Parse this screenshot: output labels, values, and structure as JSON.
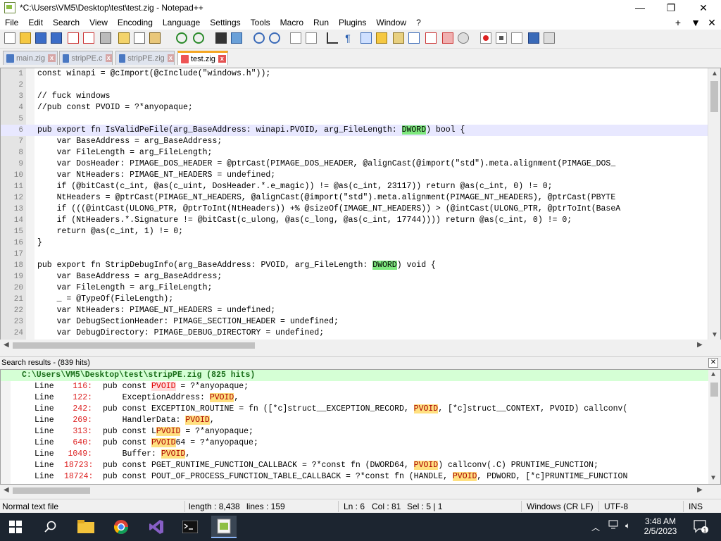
{
  "window": {
    "title": "*C:\\Users\\VM5\\Desktop\\test\\test.zig - Notepad++",
    "minimize": "—",
    "maximize": "❐",
    "close": "✕"
  },
  "menu": {
    "items": [
      "File",
      "Edit",
      "Search",
      "View",
      "Encoding",
      "Language",
      "Settings",
      "Tools",
      "Macro",
      "Run",
      "Plugins",
      "Window",
      "?"
    ],
    "plus": "+",
    "dropdown": "▼",
    "close": "✕"
  },
  "tabs": [
    {
      "label": "main.zig"
    },
    {
      "label": "stripPE.c"
    },
    {
      "label": "stripPE.zig"
    },
    {
      "label": "test.zig"
    }
  ],
  "editor": {
    "lines": [
      {
        "n": "1",
        "pre": "const winapi = @cImport(@cInclude(\"windows.h\"));"
      },
      {
        "n": "2",
        "pre": ""
      },
      {
        "n": "3",
        "pre": "// fuck windows"
      },
      {
        "n": "4",
        "pre": "//pub const PVOID = ?*anyopaque;"
      },
      {
        "n": "5",
        "pre": ""
      },
      {
        "n": "6",
        "pre": "pub export fn IsValidPeFile(arg_BaseAddress: winapi.PVOID, arg_FileLength: ",
        "hl": "DWORD",
        "post": ") bool {"
      },
      {
        "n": "7",
        "pre": "    var BaseAddress = arg_BaseAddress;"
      },
      {
        "n": "8",
        "pre": "    var FileLength = arg_FileLength;"
      },
      {
        "n": "9",
        "pre": "    var DosHeader: PIMAGE_DOS_HEADER = @ptrCast(PIMAGE_DOS_HEADER, @alignCast(@import(\"std\").meta.alignment(PIMAGE_DOS_"
      },
      {
        "n": "10",
        "pre": "    var NtHeaders: PIMAGE_NT_HEADERS = undefined;"
      },
      {
        "n": "11",
        "pre": "    if (@bitCast(c_int, @as(c_uint, DosHeader.*.e_magic)) != @as(c_int, 23117)) return @as(c_int, 0) != 0;"
      },
      {
        "n": "12",
        "pre": "    NtHeaders = @ptrCast(PIMAGE_NT_HEADERS, @alignCast(@import(\"std\").meta.alignment(PIMAGE_NT_HEADERS), @ptrCast(PBYTE"
      },
      {
        "n": "13",
        "pre": "    if (((@intCast(ULONG_PTR, @ptrToInt(NtHeaders)) +% @sizeOf(IMAGE_NT_HEADERS)) > (@intCast(ULONG_PTR, @ptrToInt(BaseA"
      },
      {
        "n": "14",
        "pre": "    if (NtHeaders.*.Signature != @bitCast(c_ulong, @as(c_long, @as(c_int, 17744)))) return @as(c_int, 0) != 0;"
      },
      {
        "n": "15",
        "pre": "    return @as(c_int, 1) != 0;"
      },
      {
        "n": "16",
        "pre": "}"
      },
      {
        "n": "17",
        "pre": ""
      },
      {
        "n": "18",
        "pre": "pub export fn StripDebugInfo(arg_BaseAddress: PVOID, arg_FileLength: ",
        "hl": "DWORD",
        "post": ") void {"
      },
      {
        "n": "19",
        "pre": "    var BaseAddress = arg_BaseAddress;"
      },
      {
        "n": "20",
        "pre": "    var FileLength = arg_FileLength;"
      },
      {
        "n": "21",
        "pre": "    _ = @TypeOf(FileLength);"
      },
      {
        "n": "22",
        "pre": "    var NtHeaders: PIMAGE_NT_HEADERS = undefined;"
      },
      {
        "n": "23",
        "pre": "    var DebugSectionHeader: PIMAGE_SECTION_HEADER = undefined;"
      },
      {
        "n": "24",
        "pre": "    var DebugDirectory: PIMAGE_DEBUG_DIRECTORY = undefined;"
      }
    ]
  },
  "search": {
    "title": "Search results - (839 hits)",
    "close": "✕",
    "file_line": "C:\\Users\\VM5\\Desktop\\test\\stripPE.zig (825 hits)",
    "results": [
      {
        "label": "Line",
        "num": "116:",
        "pre": "pub const ",
        "hit": "PVOID",
        "post": " = ?*anyopaque;",
        "first": true
      },
      {
        "label": "Line",
        "num": "122:",
        "pre": "    ExceptionAddress: ",
        "hit": "PVOID",
        "post": ","
      },
      {
        "label": "Line",
        "num": "242:",
        "pre": "pub const EXCEPTION_ROUTINE = fn ([*c]struct__EXCEPTION_RECORD, ",
        "hit": "PVOID",
        "post": ", [*c]struct__CONTEXT, PVOID) callconv("
      },
      {
        "label": "Line",
        "num": "269:",
        "pre": "    HandlerData: ",
        "hit": "PVOID",
        "post": ","
      },
      {
        "label": "Line",
        "num": "313:",
        "pre": "pub const L",
        "hit": "PVOID",
        "post": " = ?*anyopaque;"
      },
      {
        "label": "Line",
        "num": "640:",
        "pre": "pub const ",
        "hit": "PVOID",
        "post": "64 = ?*anyopaque;"
      },
      {
        "label": "Line",
        "num": "1049:",
        "pre": "    Buffer: ",
        "hit": "PVOID",
        "post": ","
      },
      {
        "label": "Line",
        "num": "18723:",
        "pre": "pub const PGET_RUNTIME_FUNCTION_CALLBACK = ?*const fn (DWORD64, ",
        "hit": "PVOID",
        "post": ") callconv(.C) PRUNTIME_FUNCTION;"
      },
      {
        "label": "Line",
        "num": "18724:",
        "pre": "pub const POUT_OF_PROCESS_FUNCTION_TABLE_CALLBACK = ?*const fn (HANDLE, ",
        "hit": "PVOID",
        "post": ", PDWORD, [*c]PRUNTIME_FUNCTION"
      }
    ]
  },
  "status": {
    "type": "Normal text file",
    "length": "length : 8,438",
    "lines": "lines : 159",
    "ln": "Ln : 6",
    "col": "Col : 81",
    "sel": "Sel : 5 | 1",
    "eol": "Windows (CR LF)",
    "encoding": "UTF-8",
    "mode": "INS"
  },
  "taskbar": {
    "time": "3:48 AM",
    "date": "2/5/2023",
    "notifications": "1"
  },
  "colors": {
    "highlight": "#7ee87e",
    "search_hit": "#ffe080",
    "taskbar": "#1c2530"
  }
}
